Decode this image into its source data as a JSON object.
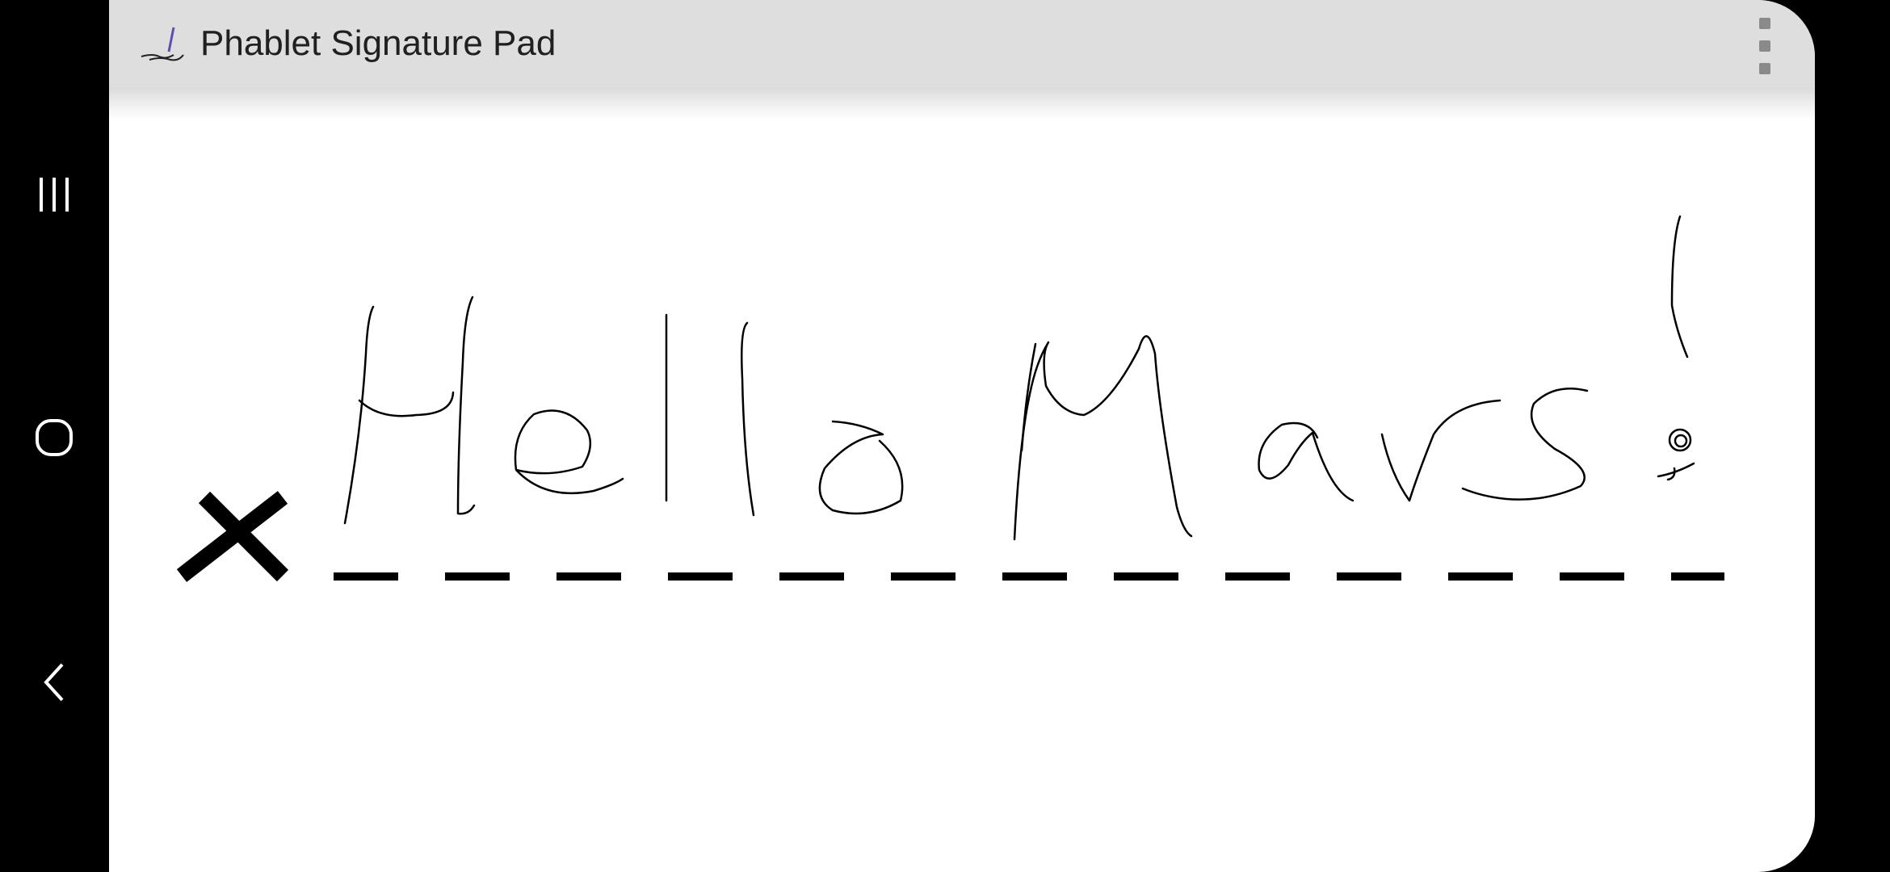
{
  "app": {
    "title": "Phablet Signature Pad",
    "icon": "pen-signature-icon"
  },
  "menu": {
    "icon": "overflow-menu-icon"
  },
  "system_nav": {
    "recents_icon": "recents-icon",
    "home_icon": "home-icon",
    "back_icon": "back-icon"
  },
  "signature_pad": {
    "mark_icon": "x-mark-icon",
    "handwritten_text": "Hello Mars!",
    "stroke_color": "#000000",
    "background_color": "#ffffff"
  },
  "colors": {
    "action_bar": "#dedede",
    "system_bar": "#000000"
  }
}
